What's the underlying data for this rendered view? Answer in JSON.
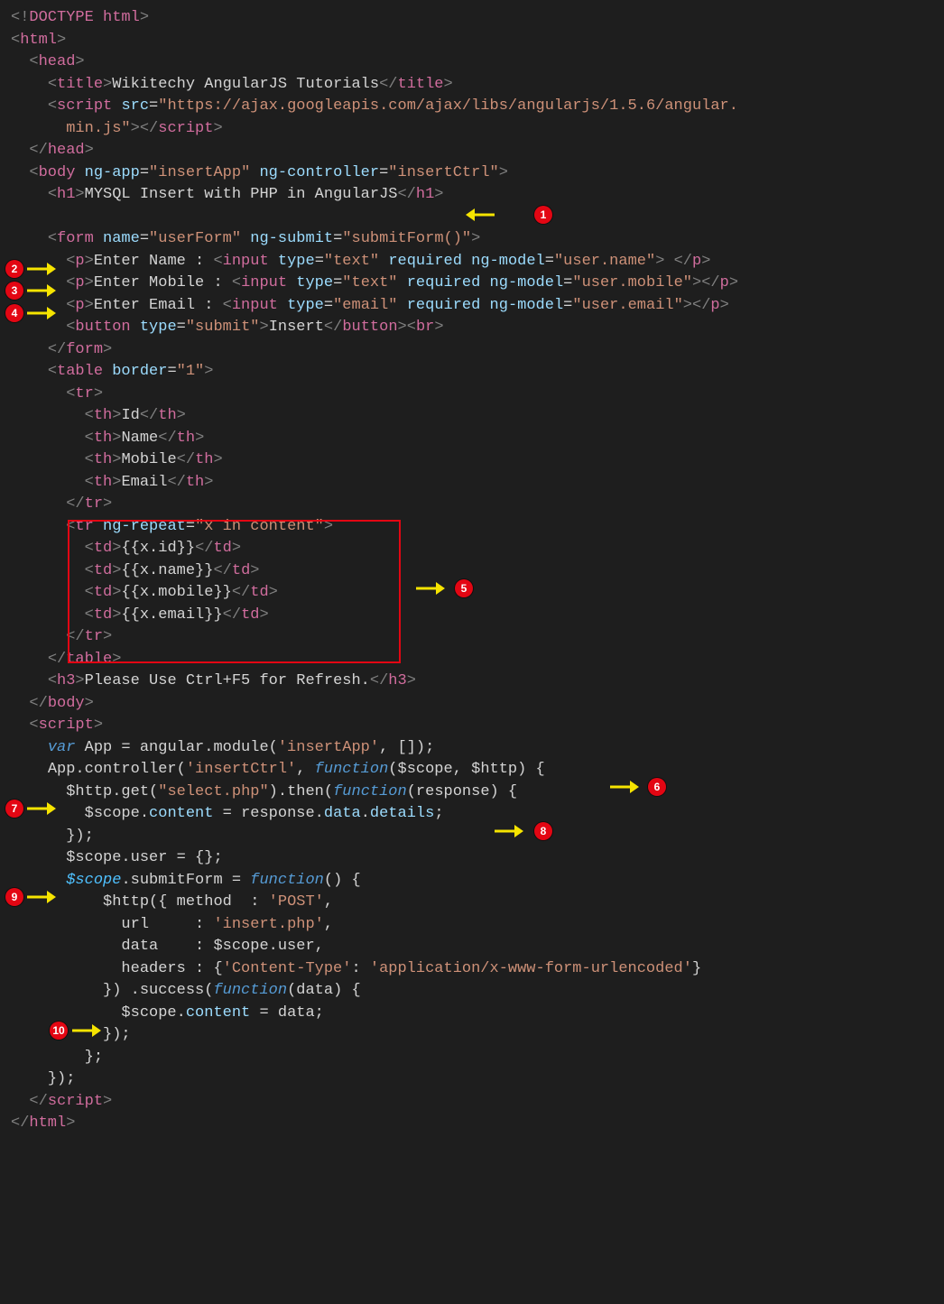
{
  "doc": "DOCTYPE html",
  "tags": {
    "html": "html",
    "head": "head",
    "title": "title",
    "script": "script",
    "body": "body",
    "h1": "h1",
    "form": "form",
    "p": "p",
    "input": "input",
    "button": "button",
    "br": "br",
    "table": "table",
    "tr": "tr",
    "th": "th",
    "td": "td",
    "h3": "h3"
  },
  "attrs": {
    "src": "src",
    "ngapp": "ng-app",
    "ngctrl": "ng-controller",
    "name": "name",
    "ngsubmit": "ng-submit",
    "type": "type",
    "required": "required",
    "ngmodel": "ng-model",
    "border": "border",
    "ngrepeat": "ng-repeat"
  },
  "vals": {
    "title": "Wikitechy AngularJS Tutorials",
    "scriptSrc1": "\"https://ajax.googleapis.com/ajax/libs/angularjs/1.5.6/angular.",
    "scriptSrc2": "min.js\"",
    "app": "\"insertApp\"",
    "ctrl": "\"insertCtrl\"",
    "h1": "MYSQL Insert with PHP in AngularJS",
    "formName": "\"userForm\"",
    "submit": "\"submitForm()\"",
    "enterName": "Enter Name : ",
    "enterMobile": "Enter Mobile : ",
    "enterEmail": "Enter Email : ",
    "typeText": "\"text\"",
    "typeEmail": "\"email\"",
    "typeSubmit": "\"submit\"",
    "modelName": "\"user.name\"",
    "modelMobile": "\"user.mobile\"",
    "modelEmail": "\"user.email\"",
    "insert": "Insert",
    "border1": "\"1\"",
    "thId": "Id",
    "thName": "Name",
    "thMobile": "Mobile",
    "thEmail": "Email",
    "repeat": "\"x in content\"",
    "tdId": "{{x.id}}",
    "tdName": "{{x.name}}",
    "tdMobile": "{{x.mobile}}",
    "tdEmail": "{{x.email}}",
    "h3": "Please Use Ctrl+F5 for Refresh."
  },
  "js": {
    "var": "var",
    "function": "function",
    "app": " App = angular.module(",
    "appArg1": "'insertApp'",
    "appArg2": ", []);",
    "ctrlCall": "App.controller(",
    "ctrlArg": "'insertCtrl'",
    "ctrlComma": ", ",
    "fnArgs": "($scope, $http) {",
    "httpGet1": "$http.get(",
    "selectPhp": "\"select.php\"",
    "then": ").then(",
    "respArgs": "(response) {",
    "scopeContent": "$scope.",
    "contentAssign": " = response.",
    "dot": ".",
    "content": "content",
    "data": "data",
    "details": "details",
    "semi": ";",
    "closeFn": "});",
    "userInit": "$scope.user = {};",
    "scopeItc": "$scope",
    "submitForm1": ".submitForm = ",
    "submitForm2": "() {",
    "httpPost": "$http({ method  : ",
    "post": "'POST'",
    "urlLine": "url     : ",
    "insertPhp": "'insert.php'",
    "dataLine": "data    : $scope.user,",
    "headersLine": "headers : {",
    "contentType": "'Content-Type'",
    "colon": ": ",
    "formenc": "'application/x-www-form-urlencoded'",
    "closeObj": "}",
    "success1": "}) .success(",
    "successArgs": "(data) {",
    "assignData": " = data;",
    "close1": "});",
    "close2": "};",
    "close3": "});"
  },
  "annotations": [
    {
      "n": "1",
      "target": "form element / ng-submit"
    },
    {
      "n": "2",
      "target": "first <p> with name input"
    },
    {
      "n": "3",
      "target": "second <p> with mobile input"
    },
    {
      "n": "4",
      "target": "third <p> with email input"
    },
    {
      "n": "5",
      "target": "ng-repeat <tr> block (red box)"
    },
    {
      "n": "6",
      "target": "controller function header"
    },
    {
      "n": "7",
      "target": "$http.get(\"select.php\")"
    },
    {
      "n": "8",
      "target": "$scope.content = response.data.details;"
    },
    {
      "n": "9",
      "target": "$scope.submitForm = function()"
    },
    {
      "n": "10",
      "target": "$scope.content = data;"
    }
  ],
  "box_target": "tr ng-repeat block with td bindings"
}
